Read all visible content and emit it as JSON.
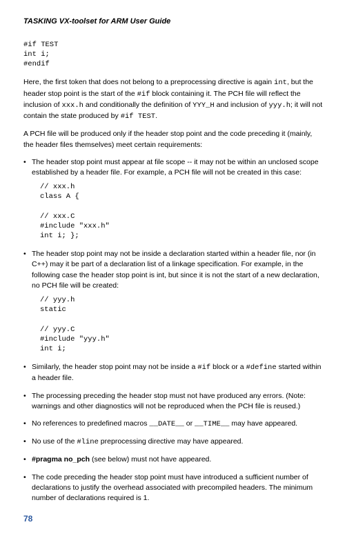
{
  "doc_title": "TASKING VX-toolset for ARM User Guide",
  "code1": "#if TEST\nint i;\n#endif",
  "para1_a": "Here, the first token that does not belong to a preprocessing directive is again ",
  "para1_b": ", but the header stop point is the start of the ",
  "para1_c": " block containing it. The PCH file will reflect the inclusion of ",
  "para1_d": " and conditionally the definition of ",
  "para1_e": " and inclusion of ",
  "para1_f": "; it will not contain the state produced by ",
  "para1_g": ".",
  "tok_int": "int",
  "tok_ifblk": "#if",
  "tok_xxxh": "xxx.h",
  "tok_YYYH": "YYY_H",
  "tok_yyyh": "yyy.h",
  "tok_iftest": "#if TEST",
  "para2": "A PCH file will be produced only if the header stop point and the code preceding it (mainly, the header files themselves) meet certain requirements:",
  "b1": "The header stop point must appear at file scope -- it may not be within an unclosed scope established by a header file. For example, a PCH file will not be created in this case:",
  "code2": "// xxx.h\nclass A {\n\n// xxx.C\n#include \"xxx.h\"\nint i; };",
  "b2": "The header stop point may not be inside a declaration started within a header file, nor (in C++) may it be part of a declaration list of a linkage specification. For example, in the following case the header stop point is int, but since it is not the start of a new declaration, no PCH file will be created:",
  "code3": "// yyy.h\nstatic\n\n// yyy.C\n#include \"yyy.h\"\nint i;",
  "b3_a": "Similarly, the header stop point may not be inside a ",
  "b3_b": " block or a ",
  "b3_c": " started within a header file.",
  "tok_if": "#if",
  "tok_define": "#define",
  "b4": "The processing preceding the header stop must not have produced any errors. (Note: warnings and other diagnostics will not be reproduced when the PCH file is reused.)",
  "b5_a": "No references to predefined macros ",
  "b5_b": " or ",
  "b5_c": " may have appeared.",
  "tok_date": "__DATE__",
  "tok_time": "__TIME__",
  "b6_a": "No use of the ",
  "b6_b": " preprocessing directive may have appeared.",
  "tok_line": "#line",
  "b7_a": "#pragma no_pch",
  "b7_b": " (see below) must not have appeared.",
  "b8": "The code preceding the header stop point must have introduced a sufficient number of declarations to justify the overhead associated with precompiled headers. The minimum number of declarations required is 1.",
  "page_number": "78"
}
